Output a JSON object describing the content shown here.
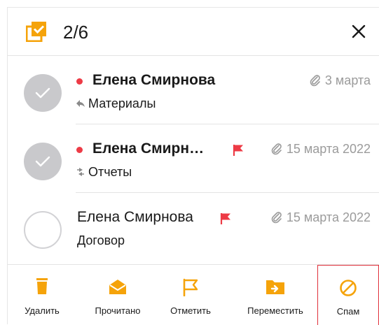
{
  "header": {
    "selection_count": "2/6"
  },
  "colors": {
    "accent": "#f5a30a",
    "unread_dot": "#ed3b46",
    "flag": "#ed3b46"
  },
  "messages": [
    {
      "sender": "Елена Смирнова",
      "subject": "Материалы",
      "date": "3 марта",
      "unread": true,
      "selected": true,
      "flagged": false,
      "has_attachment": true,
      "subject_icon": "reply-icon"
    },
    {
      "sender": "Елена Смирн…",
      "subject": "Отчеты",
      "date": "15 марта 2022",
      "unread": true,
      "selected": true,
      "flagged": true,
      "has_attachment": true,
      "subject_icon": "forward-icon"
    },
    {
      "sender": "Елена Смирнова",
      "subject": "Договор",
      "date": "15 марта 2022",
      "unread": false,
      "selected": false,
      "flagged": true,
      "has_attachment": true,
      "subject_icon": ""
    }
  ],
  "actions": [
    {
      "label": "Удалить",
      "icon": "trash-icon"
    },
    {
      "label": "Прочитано",
      "icon": "open-envelope-icon"
    },
    {
      "label": "Отметить",
      "icon": "flag-icon"
    },
    {
      "label": "Переместить",
      "icon": "move-folder-icon"
    },
    {
      "label": "Спам",
      "icon": "spam-icon"
    }
  ]
}
